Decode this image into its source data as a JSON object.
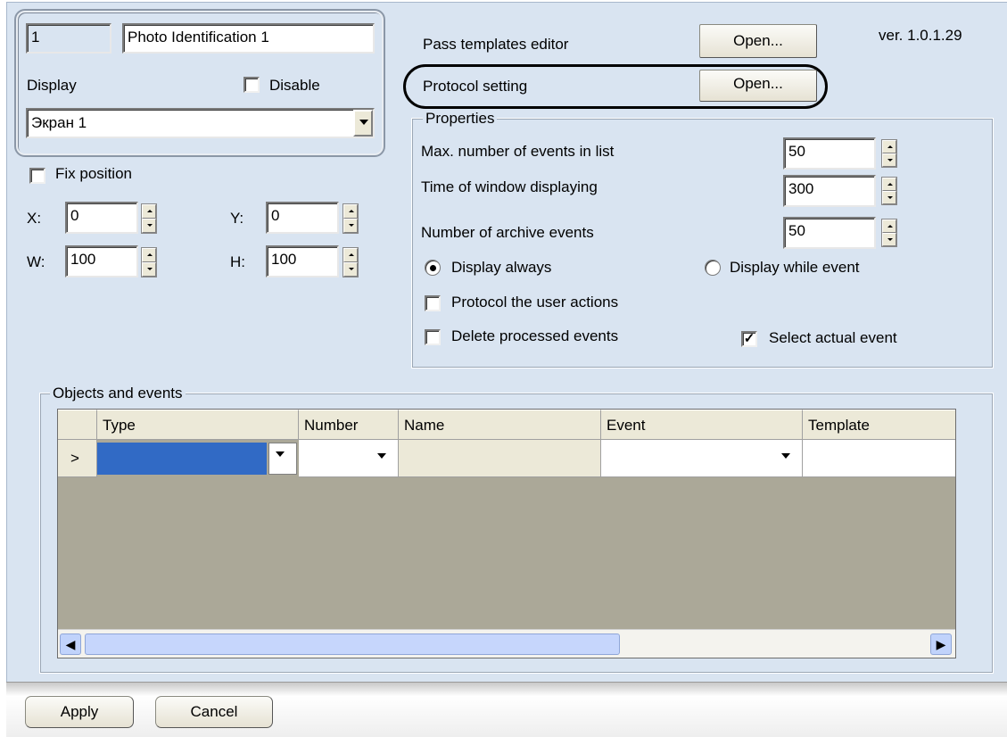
{
  "top_panel": {
    "id_value": "1",
    "name_value": "Photo Identification 1",
    "display_label": "Display",
    "disable_label": "Disable",
    "disable_checked": false,
    "screen_value": "Экран 1"
  },
  "position": {
    "fix_label": "Fix position",
    "fix_checked": false,
    "x_label": "X:",
    "x_value": "0",
    "y_label": "Y:",
    "y_value": "0",
    "w_label": "W:",
    "w_value": "100",
    "h_label": "H:",
    "h_value": "100"
  },
  "editors": {
    "pass_templates_label": "Pass templates editor",
    "pass_templates_button": "Open...",
    "protocol_setting_label": "Protocol setting",
    "protocol_setting_button": "Open...",
    "version": "ver. 1.0.1.29"
  },
  "properties": {
    "group_label": "Properties",
    "max_events_label": "Max. number of events in list",
    "max_events_value": "50",
    "time_window_label": "Time of window displaying",
    "time_window_value": "300",
    "archive_events_label": "Number of archive events",
    "archive_events_value": "50",
    "display_always_label": "Display always",
    "display_always_selected": true,
    "display_while_label": "Display while event",
    "display_while_selected": false,
    "protocol_actions_label": "Protocol the user actions",
    "protocol_actions_checked": false,
    "delete_processed_label": "Delete processed events",
    "delete_processed_checked": false,
    "select_actual_label": "Select actual event",
    "select_actual_checked": true
  },
  "objects": {
    "group_label": "Objects and events",
    "columns": [
      "Type",
      "Number",
      "Name",
      "Event",
      "Template"
    ],
    "row_indicator": ">"
  },
  "footer": {
    "apply_label": "Apply",
    "cancel_label": "Cancel"
  },
  "colors": {
    "window_bg": "#d9e4f1",
    "grid_empty": "#aba898",
    "selection": "#316ac5",
    "highlight_ellipse": "#000000"
  }
}
